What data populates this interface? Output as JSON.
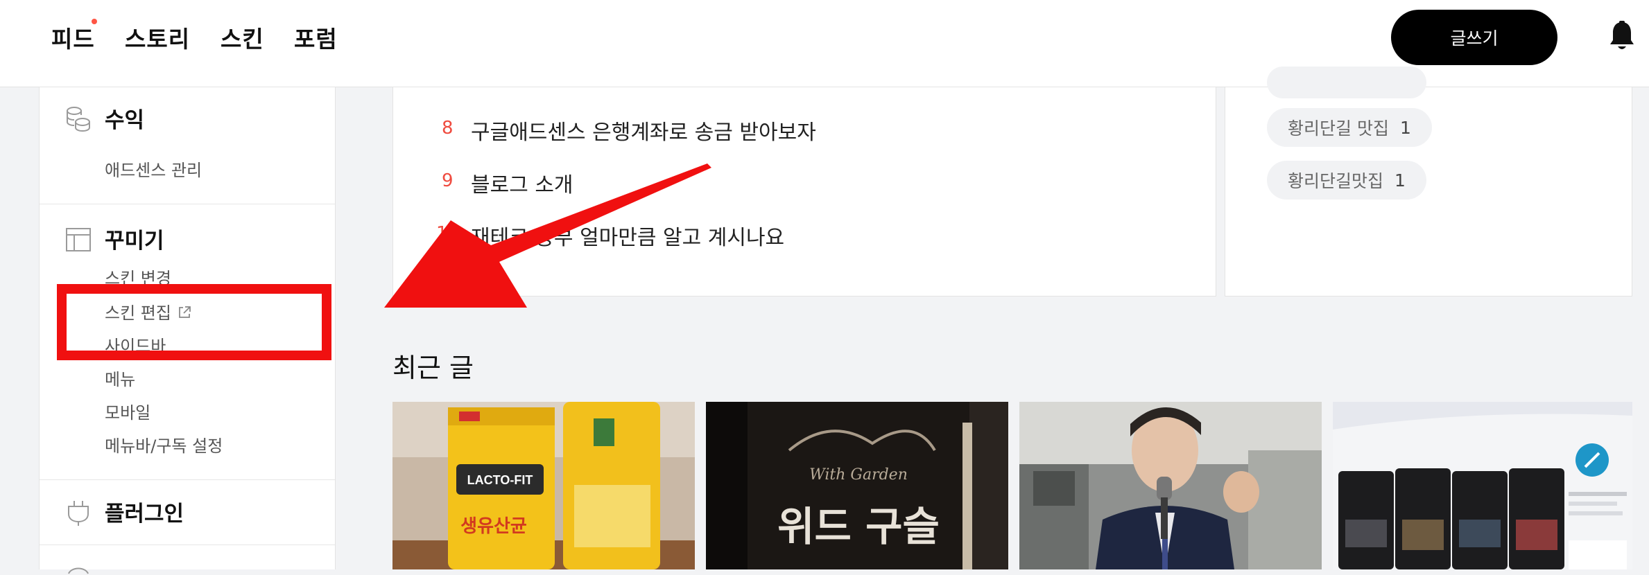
{
  "header": {
    "nav": [
      "피드",
      "스토리",
      "스킨",
      "포럼"
    ],
    "write_label": "글쓰기"
  },
  "sidebar": {
    "revenue": {
      "title": "수익",
      "items": [
        "애드센스 관리"
      ]
    },
    "decorate": {
      "title": "꾸미기",
      "items": [
        "스킨 변경",
        "스킨 편집",
        "사이드바",
        "메뉴",
        "모바일",
        "메뉴바/구독 설정"
      ]
    },
    "plugin": {
      "title": "플러그인"
    }
  },
  "popular": {
    "items": [
      {
        "rank": "8",
        "title": "구글애드센스 은행계좌로 송금 받아보자"
      },
      {
        "rank": "9",
        "title": "블로그 소개"
      },
      {
        "rank": "10",
        "title": "재테크 공부 얼마만큼 알고 계시나요"
      }
    ]
  },
  "tags": [
    {
      "name": "황리단길 맛집",
      "count": "1"
    },
    {
      "name": "황리단길맛집",
      "count": "1"
    }
  ],
  "recent": {
    "title": "최근 글",
    "thumbs": [
      {
        "desc": "lacto-fit-probiotics-photo",
        "label_lacto": "LACTO-FIT",
        "label_kr": "생유산균"
      },
      {
        "desc": "restaurant-sign-photo",
        "label_script": "With Garden",
        "label_kr": "위드 구슬"
      },
      {
        "desc": "speaker-with-microphone-photo"
      },
      {
        "desc": "mobile-app-screenshots"
      }
    ]
  },
  "colors": {
    "accent_red": "#ef4b3f",
    "annotation_red": "#f01010",
    "button_black": "#000000",
    "page_bg": "#f2f3f5"
  }
}
